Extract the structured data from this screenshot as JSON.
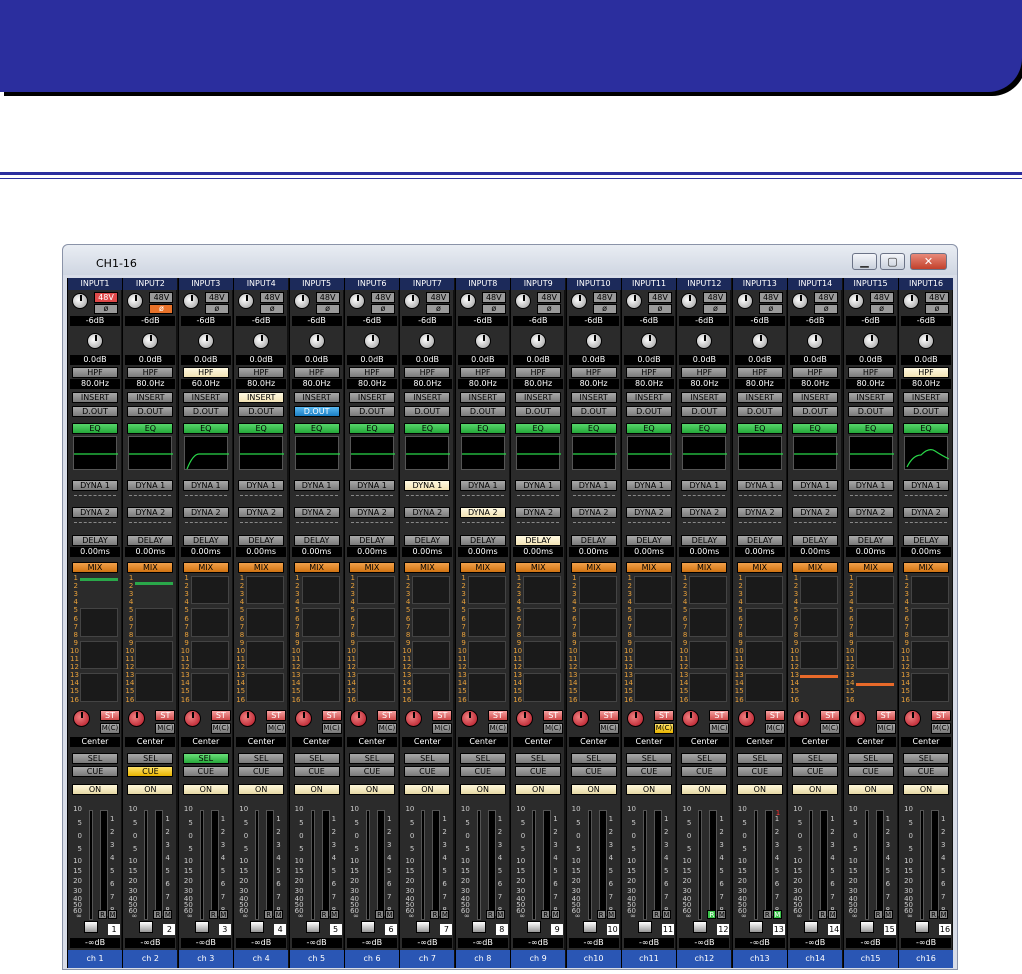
{
  "window": {
    "title": "CH1-16"
  },
  "channels": [
    {
      "input": "INPUT1",
      "gain": "-6dB",
      "p48": "48V",
      "p48_on": true,
      "phase_on": false,
      "trim": "0.0dB",
      "hpf": "80.0Hz",
      "hpf_on": false,
      "insert_on": false,
      "dout_on": false,
      "eq_curve": "flat",
      "dyna1_on": false,
      "dyna2_on": false,
      "delay": "0.00ms",
      "delay_on": false,
      "bus_level": "bar-1",
      "pan": "Center",
      "mc_on": false,
      "sel_on": false,
      "cue_on": false,
      "r_on": false,
      "m_on": false,
      "fader": "-∞dB",
      "num": "1",
      "name": "ch 1"
    },
    {
      "input": "INPUT2",
      "gain": "-6dB",
      "p48": "48V",
      "p48_on": false,
      "phase_on": true,
      "trim": "0.0dB",
      "hpf": "80.0Hz",
      "hpf_on": false,
      "insert_on": false,
      "dout_on": false,
      "eq_curve": "flat",
      "dyna1_on": false,
      "dyna2_on": false,
      "delay": "0.00ms",
      "delay_on": false,
      "bus_level": "bar-2",
      "pan": "Center",
      "mc_on": false,
      "sel_on": false,
      "cue_on": true,
      "r_on": false,
      "m_on": false,
      "fader": "-∞dB",
      "num": "2",
      "name": "ch 2"
    },
    {
      "input": "INPUT3",
      "gain": "-6dB",
      "p48": "48V",
      "p48_on": false,
      "phase_on": false,
      "trim": "0.0dB",
      "hpf": "60.0Hz",
      "hpf_on": true,
      "insert_on": false,
      "dout_on": false,
      "eq_curve": "lowcut",
      "dyna1_on": false,
      "dyna2_on": false,
      "delay": "0.00ms",
      "delay_on": false,
      "bus_level": "none",
      "pan": "Center",
      "mc_on": false,
      "sel_on": true,
      "cue_on": false,
      "r_on": false,
      "m_on": false,
      "fader": "-∞dB",
      "num": "3",
      "name": "ch 3"
    },
    {
      "input": "INPUT4",
      "gain": "-6dB",
      "p48": "48V",
      "p48_on": false,
      "phase_on": false,
      "trim": "0.0dB",
      "hpf": "80.0Hz",
      "hpf_on": false,
      "insert_on": true,
      "dout_on": false,
      "eq_curve": "flat",
      "dyna1_on": false,
      "dyna2_on": false,
      "delay": "0.00ms",
      "delay_on": false,
      "bus_level": "none",
      "pan": "Center",
      "mc_on": false,
      "sel_on": false,
      "cue_on": false,
      "r_on": false,
      "m_on": false,
      "fader": "-∞dB",
      "num": "4",
      "name": "ch 4"
    },
    {
      "input": "INPUT5",
      "gain": "-6dB",
      "p48": "48V",
      "p48_on": false,
      "phase_on": false,
      "trim": "0.0dB",
      "hpf": "80.0Hz",
      "hpf_on": false,
      "insert_on": false,
      "dout_on": true,
      "eq_curve": "flat",
      "dyna1_on": false,
      "dyna2_on": false,
      "delay": "0.00ms",
      "delay_on": false,
      "bus_level": "none",
      "pan": "Center",
      "mc_on": false,
      "sel_on": false,
      "cue_on": false,
      "r_on": false,
      "m_on": false,
      "fader": "-∞dB",
      "num": "5",
      "name": "ch 5"
    },
    {
      "input": "INPUT6",
      "gain": "-6dB",
      "p48": "48V",
      "p48_on": false,
      "phase_on": false,
      "trim": "0.0dB",
      "hpf": "80.0Hz",
      "hpf_on": false,
      "insert_on": false,
      "dout_on": false,
      "eq_curve": "flat",
      "dyna1_on": false,
      "dyna2_on": false,
      "delay": "0.00ms",
      "delay_on": false,
      "bus_level": "none",
      "pan": "Center",
      "mc_on": false,
      "sel_on": false,
      "cue_on": false,
      "r_on": false,
      "m_on": false,
      "fader": "-∞dB",
      "num": "6",
      "name": "ch 6"
    },
    {
      "input": "INPUT7",
      "gain": "-6dB",
      "p48": "48V",
      "p48_on": false,
      "phase_on": false,
      "trim": "0.0dB",
      "hpf": "80.0Hz",
      "hpf_on": false,
      "insert_on": false,
      "dout_on": false,
      "eq_curve": "flat",
      "dyna1_on": true,
      "dyna2_on": false,
      "delay": "0.00ms",
      "delay_on": false,
      "bus_level": "none",
      "pan": "Center",
      "mc_on": false,
      "sel_on": false,
      "cue_on": false,
      "r_on": false,
      "m_on": false,
      "fader": "-∞dB",
      "num": "7",
      "name": "ch 7"
    },
    {
      "input": "INPUT8",
      "gain": "-6dB",
      "p48": "48V",
      "p48_on": false,
      "phase_on": false,
      "trim": "0.0dB",
      "hpf": "80.0Hz",
      "hpf_on": false,
      "insert_on": false,
      "dout_on": false,
      "eq_curve": "flat",
      "dyna1_on": false,
      "dyna2_on": true,
      "delay": "0.00ms",
      "delay_on": false,
      "bus_level": "none",
      "pan": "Center",
      "mc_on": false,
      "sel_on": false,
      "cue_on": false,
      "r_on": false,
      "m_on": false,
      "fader": "-∞dB",
      "num": "8",
      "name": "ch 8"
    },
    {
      "input": "INPUT9",
      "gain": "-6dB",
      "p48": "48V",
      "p48_on": false,
      "phase_on": false,
      "trim": "0.0dB",
      "hpf": "80.0Hz",
      "hpf_on": false,
      "insert_on": false,
      "dout_on": false,
      "eq_curve": "flat",
      "dyna1_on": false,
      "dyna2_on": false,
      "delay": "0.00ms",
      "delay_on": true,
      "bus_level": "none",
      "pan": "Center",
      "mc_on": false,
      "sel_on": false,
      "cue_on": false,
      "r_on": false,
      "m_on": false,
      "fader": "-∞dB",
      "num": "9",
      "name": "ch 9"
    },
    {
      "input": "INPUT10",
      "gain": "-6dB",
      "p48": "48V",
      "p48_on": false,
      "phase_on": false,
      "trim": "0.0dB",
      "hpf": "80.0Hz",
      "hpf_on": false,
      "insert_on": false,
      "dout_on": false,
      "eq_curve": "flat",
      "dyna1_on": false,
      "dyna2_on": false,
      "delay": "0.00ms",
      "delay_on": false,
      "bus_level": "none",
      "pan": "Center",
      "mc_on": false,
      "sel_on": false,
      "cue_on": false,
      "r_on": false,
      "m_on": false,
      "fader": "-∞dB",
      "num": "10",
      "name": "ch10"
    },
    {
      "input": "INPUT11",
      "gain": "-6dB",
      "p48": "48V",
      "p48_on": false,
      "phase_on": false,
      "trim": "0.0dB",
      "hpf": "80.0Hz",
      "hpf_on": false,
      "insert_on": false,
      "dout_on": false,
      "eq_curve": "flat",
      "dyna1_on": false,
      "dyna2_on": false,
      "delay": "0.00ms",
      "delay_on": false,
      "bus_level": "none",
      "pan": "Center",
      "mc_on": true,
      "sel_on": false,
      "cue_on": false,
      "r_on": false,
      "m_on": false,
      "fader": "-∞dB",
      "num": "11",
      "name": "ch11"
    },
    {
      "input": "INPUT12",
      "gain": "-6dB",
      "p48": "48V",
      "p48_on": false,
      "phase_on": false,
      "trim": "0.0dB",
      "hpf": "80.0Hz",
      "hpf_on": false,
      "insert_on": false,
      "dout_on": false,
      "eq_curve": "flat",
      "dyna1_on": false,
      "dyna2_on": false,
      "delay": "0.00ms",
      "delay_on": false,
      "bus_level": "none",
      "pan": "Center",
      "mc_on": false,
      "sel_on": false,
      "cue_on": false,
      "r_on": true,
      "m_on": false,
      "fader": "-∞dB",
      "num": "12",
      "name": "ch12"
    },
    {
      "input": "INPUT13",
      "gain": "-6dB",
      "p48": "48V",
      "p48_on": false,
      "phase_on": false,
      "trim": "0.0dB",
      "hpf": "80.0Hz",
      "hpf_on": false,
      "insert_on": false,
      "dout_on": false,
      "eq_curve": "flat",
      "dyna1_on": false,
      "dyna2_on": false,
      "delay": "0.00ms",
      "delay_on": false,
      "bus_level": "none",
      "pan": "Center",
      "mc_on": false,
      "sel_on": false,
      "cue_on": false,
      "r_on": false,
      "m_on": true,
      "fader": "-∞dB",
      "num": "13",
      "name": "ch13"
    },
    {
      "input": "INPUT14",
      "gain": "-6dB",
      "p48": "48V",
      "p48_on": false,
      "phase_on": false,
      "trim": "0.0dB",
      "hpf": "80.0Hz",
      "hpf_on": false,
      "insert_on": false,
      "dout_on": false,
      "eq_curve": "flat",
      "dyna1_on": false,
      "dyna2_on": false,
      "delay": "0.00ms",
      "delay_on": false,
      "bus_level": "bar-14",
      "pan": "Center",
      "mc_on": false,
      "sel_on": false,
      "cue_on": false,
      "r_on": false,
      "m_on": false,
      "fader": "-∞dB",
      "num": "14",
      "name": "ch14"
    },
    {
      "input": "INPUT15",
      "gain": "-6dB",
      "p48": "48V",
      "p48_on": false,
      "phase_on": false,
      "trim": "0.0dB",
      "hpf": "80.0Hz",
      "hpf_on": false,
      "insert_on": false,
      "dout_on": false,
      "eq_curve": "flat",
      "dyna1_on": false,
      "dyna2_on": false,
      "delay": "0.00ms",
      "delay_on": false,
      "bus_level": "bar-15",
      "pan": "Center",
      "mc_on": false,
      "sel_on": false,
      "cue_on": false,
      "r_on": false,
      "m_on": false,
      "fader": "-∞dB",
      "num": "15",
      "name": "ch15"
    },
    {
      "input": "INPUT16",
      "gain": "-6dB",
      "p48": "48V",
      "p48_on": false,
      "phase_on": false,
      "trim": "0.0dB",
      "hpf": "80.0Hz",
      "hpf_on": true,
      "insert_on": false,
      "dout_on": false,
      "eq_curve": "peak",
      "dyna1_on": false,
      "dyna2_on": false,
      "delay": "0.00ms",
      "delay_on": false,
      "bus_level": "none",
      "pan": "Center",
      "mc_on": false,
      "sel_on": false,
      "cue_on": false,
      "r_on": false,
      "m_on": false,
      "fader": "-∞dB",
      "num": "16",
      "name": "ch16"
    }
  ],
  "labels": {
    "hpf": "HPF",
    "insert": "INSERT",
    "dout": "D.OUT",
    "eq": "EQ",
    "dyna1": "DYNA 1",
    "dyna2": "DYNA 2",
    "delay": "DELAY",
    "mix": "MIX",
    "st": "ST",
    "mc": "M(C)",
    "sel": "SEL",
    "cue": "CUE",
    "on": "ON",
    "phase": "ø",
    "r": "R",
    "m": "M",
    "bus_numbers": [
      "1",
      "2",
      "3",
      "4",
      "5",
      "6",
      "7",
      "8",
      "9",
      "10",
      "11",
      "12",
      "13",
      "14",
      "15",
      "16"
    ],
    "fader_scale": [
      "10",
      "5",
      "0",
      "5",
      "10",
      "15",
      "20",
      "30",
      "40",
      "50",
      "60",
      "∞"
    ],
    "meter_scale": [
      "1",
      "2",
      "3",
      "4",
      "5",
      "6",
      "7",
      "8"
    ],
    "meter_peak": "1"
  },
  "colors": {
    "banner": "#2b2e9e",
    "eq_on": "#2aa84a",
    "mix": "#e8822a",
    "dout_on": "#1a7ec4",
    "cue_on": "#f0c020",
    "sel_on": "#3ac44a",
    "pan_knob": "#c8102e",
    "ch_name": "#2a56b4"
  },
  "icons": {
    "minimize": "minimize-icon",
    "maximize": "maximize-icon",
    "close": "close-icon"
  }
}
